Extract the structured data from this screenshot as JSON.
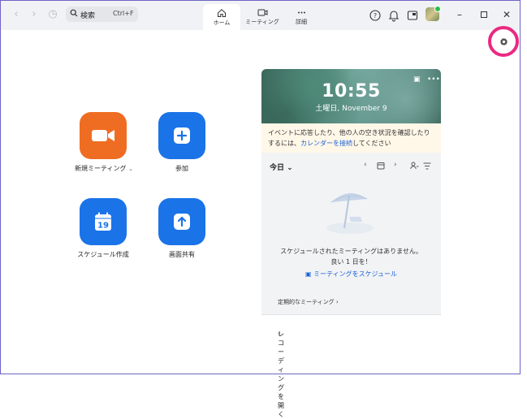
{
  "search": {
    "label": "検索",
    "shortcut": "Ctrl+F"
  },
  "tabs": [
    {
      "label": "ホーム",
      "icon": "home-icon"
    },
    {
      "label": "ミーティング",
      "icon": "video-icon"
    },
    {
      "label": "詳細",
      "icon": "more-icon"
    }
  ],
  "actions": {
    "new_meeting": "新規ミーティング",
    "join": "参加",
    "schedule": "スケジュール作成",
    "share": "画面共有"
  },
  "calendar": {
    "time": "10:55",
    "date": "土曜日, November 9",
    "notice_text": "イベントに応答したり、他の人の空き状況を確認したりするには、",
    "notice_link": "カレンダーを接続",
    "notice_tail": "してください",
    "today_label": "今日",
    "empty_line1": "スケジュールされたミーティングはありません。",
    "empty_line2": "良い 1 日を！",
    "schedule_link": "ミーティングをスケジュール",
    "recurring_label": "定期的なミーティング",
    "recording_label": "レコーディングを開く"
  },
  "colors": {
    "accent": "#1b73e8",
    "orange": "#ef6d22",
    "highlight": "#ea2a82"
  }
}
